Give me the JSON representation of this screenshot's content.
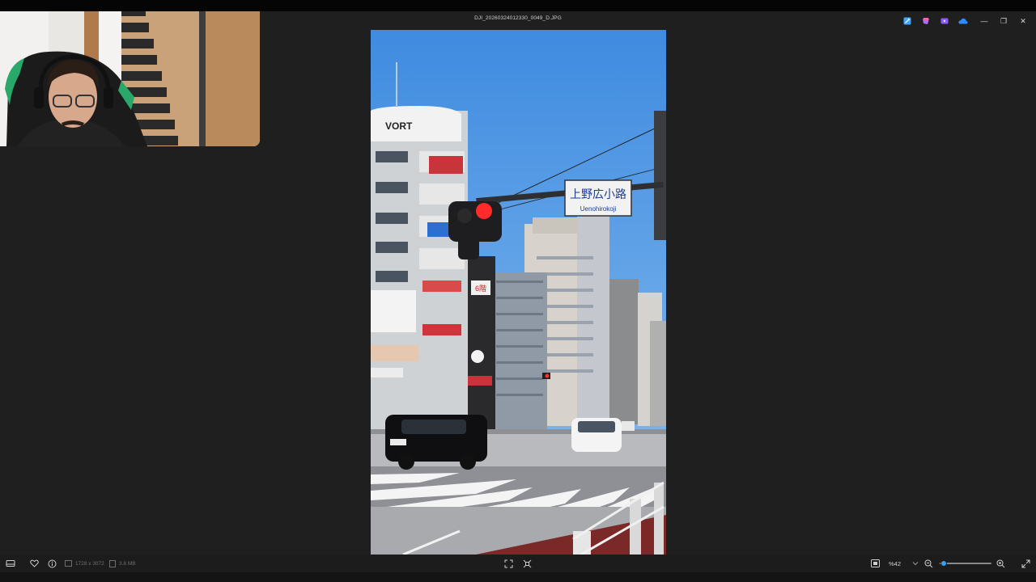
{
  "window": {
    "title": "DJI_20260324012330_0049_D.JPG",
    "controls": {
      "minimize": "—",
      "restore": "❐",
      "close": "✕"
    }
  },
  "titlebar_icons": [
    {
      "name": "edit-icon",
      "color": "#3fa3ff"
    },
    {
      "name": "clipchamp-icon",
      "color": "#b06cff"
    },
    {
      "name": "video-editor-icon",
      "color": "#8a5cff"
    },
    {
      "name": "onedrive-icon",
      "color": "#2f8cff"
    }
  ],
  "photo_text": {
    "building_sign": "VORT",
    "street_sign_jp": "上野広小路",
    "street_sign_en": "Uenohirokoji",
    "floor_sign": "6階"
  },
  "statusbar": {
    "dimensions": "1728 x 3072",
    "filesize": "3.8 MB",
    "zoom": "%42",
    "zoom_level": 0.08
  },
  "colors": {
    "background": "#1f1f1f",
    "accent": "#3aa0f0",
    "sky": "#4f97e3"
  }
}
